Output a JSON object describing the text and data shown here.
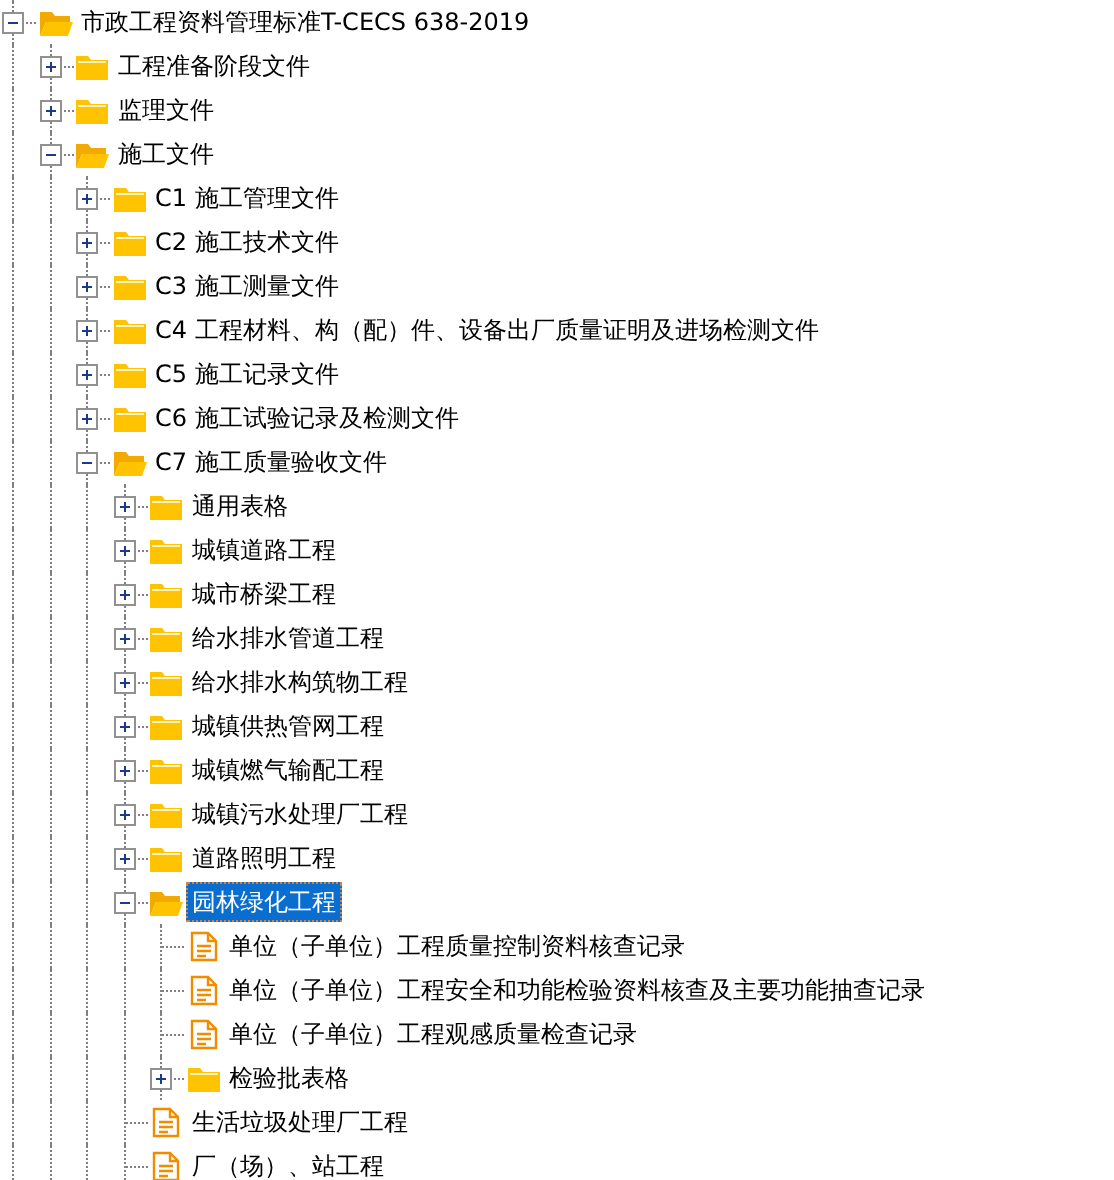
{
  "tree": [
    {
      "label": "市政工程资料管理标准T-CECS 638-2019",
      "kind": "folder",
      "expanded": true,
      "selected": false,
      "children": [
        {
          "label": "工程准备阶段文件",
          "kind": "folder",
          "expanded": false,
          "selected": false
        },
        {
          "label": "监理文件",
          "kind": "folder",
          "expanded": false,
          "selected": false
        },
        {
          "label": "施工文件",
          "kind": "folder",
          "expanded": true,
          "selected": false,
          "children": [
            {
              "label": "C1 施工管理文件",
              "kind": "folder",
              "expanded": false,
              "selected": false
            },
            {
              "label": "C2 施工技术文件",
              "kind": "folder",
              "expanded": false,
              "selected": false
            },
            {
              "label": "C3 施工测量文件",
              "kind": "folder",
              "expanded": false,
              "selected": false
            },
            {
              "label": "C4 工程材料、构（配）件、设备出厂质量证明及进场检测文件",
              "kind": "folder",
              "expanded": false,
              "selected": false
            },
            {
              "label": "C5 施工记录文件",
              "kind": "folder",
              "expanded": false,
              "selected": false
            },
            {
              "label": "C6 施工试验记录及检测文件",
              "kind": "folder",
              "expanded": false,
              "selected": false
            },
            {
              "label": "C7 施工质量验收文件",
              "kind": "folder",
              "expanded": true,
              "selected": false,
              "children": [
                {
                  "label": "通用表格",
                  "kind": "folder",
                  "expanded": false,
                  "selected": false
                },
                {
                  "label": "城镇道路工程",
                  "kind": "folder",
                  "expanded": false,
                  "selected": false
                },
                {
                  "label": "城市桥梁工程",
                  "kind": "folder",
                  "expanded": false,
                  "selected": false
                },
                {
                  "label": "给水排水管道工程",
                  "kind": "folder",
                  "expanded": false,
                  "selected": false
                },
                {
                  "label": "给水排水构筑物工程",
                  "kind": "folder",
                  "expanded": false,
                  "selected": false
                },
                {
                  "label": "城镇供热管网工程",
                  "kind": "folder",
                  "expanded": false,
                  "selected": false
                },
                {
                  "label": "城镇燃气输配工程",
                  "kind": "folder",
                  "expanded": false,
                  "selected": false
                },
                {
                  "label": "城镇污水处理厂工程",
                  "kind": "folder",
                  "expanded": false,
                  "selected": false
                },
                {
                  "label": "道路照明工程",
                  "kind": "folder",
                  "expanded": false,
                  "selected": false
                },
                {
                  "label": "园林绿化工程",
                  "kind": "folder",
                  "expanded": true,
                  "selected": true,
                  "children": [
                    {
                      "label": "单位（子单位）工程质量控制资料核查记录",
                      "kind": "document",
                      "selected": false
                    },
                    {
                      "label": "单位（子单位）工程安全和功能检验资料核查及主要功能抽查记录",
                      "kind": "document",
                      "selected": false
                    },
                    {
                      "label": "单位（子单位）工程观感质量检查记录",
                      "kind": "document",
                      "selected": false
                    },
                    {
                      "label": "检验批表格",
                      "kind": "folder",
                      "expanded": false,
                      "selected": false
                    }
                  ]
                },
                {
                  "label": "生活垃圾处理厂工程",
                  "kind": "document",
                  "selected": false
                },
                {
                  "label": "厂（场）、站工程",
                  "kind": "document",
                  "selected": false
                }
              ]
            }
          ]
        }
      ]
    }
  ]
}
